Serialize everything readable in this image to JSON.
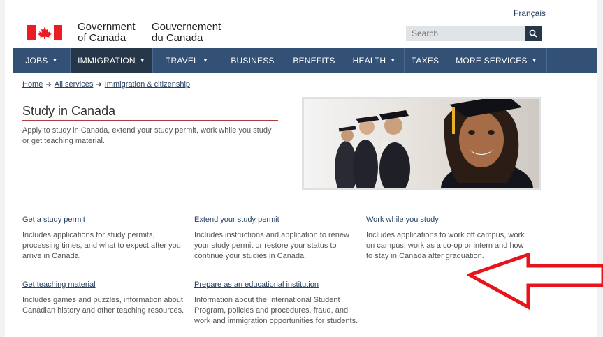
{
  "header": {
    "language_link": "Français",
    "signature_en_line1": "Government",
    "signature_en_line2": "of Canada",
    "signature_fr_line1": "Gouvernement",
    "signature_fr_line2": "du Canada",
    "search_placeholder": "Search",
    "search_icon": "search-icon",
    "flag_color": "#ea1c24"
  },
  "nav": {
    "items": [
      {
        "label": "JOBS",
        "has_menu": true
      },
      {
        "label": "IMMIGRATION",
        "has_menu": true,
        "active": true
      },
      {
        "label": "TRAVEL",
        "has_menu": true
      },
      {
        "label": "BUSINESS",
        "has_menu": false
      },
      {
        "label": "BENEFITS",
        "has_menu": false
      },
      {
        "label": "HEALTH",
        "has_menu": true
      },
      {
        "label": "TAXES",
        "has_menu": false
      },
      {
        "label": "MORE SERVICES",
        "has_menu": true
      }
    ],
    "caret": "▼",
    "bar_color": "#335075",
    "active_color": "#26374a"
  },
  "breadcrumb": {
    "items": [
      "Home",
      "All services",
      "Immigration & citizenship"
    ],
    "separator": "➔"
  },
  "main": {
    "title": "Study in Canada",
    "intro": "Apply to study in Canada, extend your study permit, work while you study or get teaching material.",
    "accent_color": "#af3c43"
  },
  "services": [
    {
      "title": "Get a study permit",
      "description": "Includes applications for study permits, processing times, and what to expect after you arrive in Canada."
    },
    {
      "title": "Extend your study permit",
      "description": "Includes instructions and application to renew your study permit or restore your status to continue your studies in Canada."
    },
    {
      "title": "Work while you study",
      "description": "Includes applications to work off campus, work on campus, work as a co-op or intern and how to stay in Canada after graduation."
    },
    {
      "title": "Get teaching material",
      "description": "Includes games and puzzles, information about Canadian history and other teaching resources."
    },
    {
      "title": "Prepare as an educational institution",
      "description": "Information about the International Student Program, policies and procedures, fraud, and work and immigration opportunities for students."
    }
  ],
  "annotation": {
    "icon": "red-arrow-icon",
    "color": "#e8141c"
  }
}
